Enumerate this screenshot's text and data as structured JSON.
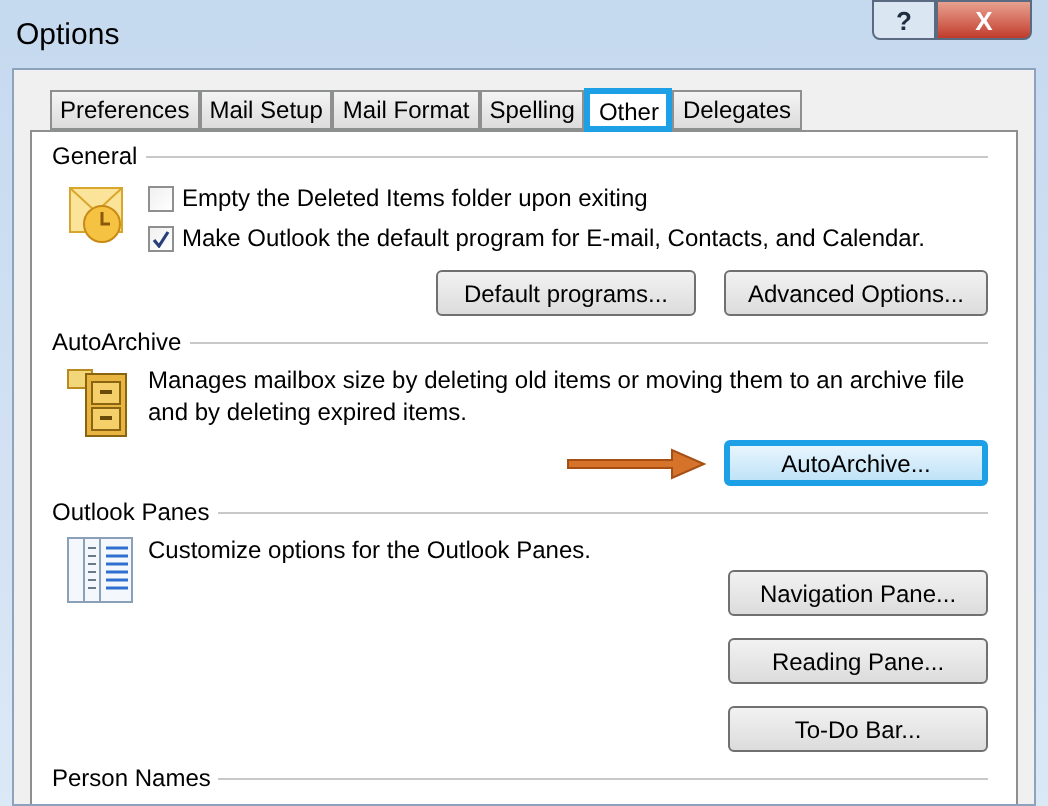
{
  "window": {
    "title": "Options",
    "title_buttons": [
      "?",
      "X"
    ]
  },
  "tabs": [
    {
      "label": "Preferences",
      "selected": false,
      "highlighted": false
    },
    {
      "label": "Mail Setup",
      "selected": false,
      "highlighted": false
    },
    {
      "label": "Mail Format",
      "selected": false,
      "highlighted": false
    },
    {
      "label": "Spelling",
      "selected": false,
      "highlighted": false
    },
    {
      "label": "Other",
      "selected": true,
      "highlighted": true
    },
    {
      "label": "Delegates",
      "selected": false,
      "highlighted": false
    }
  ],
  "sections": [
    {
      "heading": "General",
      "kind": "general",
      "checkboxes": [
        {
          "label": "Empty the Deleted Items folder upon exiting",
          "checked": false
        },
        {
          "label": "Make Outlook the default program for E-mail, Contacts, and Calendar.",
          "checked": true
        }
      ],
      "buttons": [
        {
          "label": "Default programs...",
          "highlighted": false,
          "arrow": false
        },
        {
          "label": "Advanced Options...",
          "highlighted": false,
          "arrow": false
        }
      ]
    },
    {
      "heading": "AutoArchive",
      "kind": "archive",
      "description": "Manages mailbox size by deleting old items or moving them to an archive file and by deleting expired items.",
      "buttons": [
        {
          "label": "AutoArchive...",
          "highlighted": true,
          "arrow": true
        }
      ]
    },
    {
      "heading": "Outlook Panes",
      "kind": "panes",
      "description": "Customize options for the Outlook Panes.",
      "buttons": [
        {
          "label": "Navigation Pane...",
          "highlighted": false,
          "arrow": false
        },
        {
          "label": "Reading Pane...",
          "highlighted": false,
          "arrow": false
        },
        {
          "label": "To-Do Bar...",
          "highlighted": false,
          "arrow": false
        }
      ]
    },
    {
      "heading": "Person Names",
      "kind": "heading"
    }
  ]
}
